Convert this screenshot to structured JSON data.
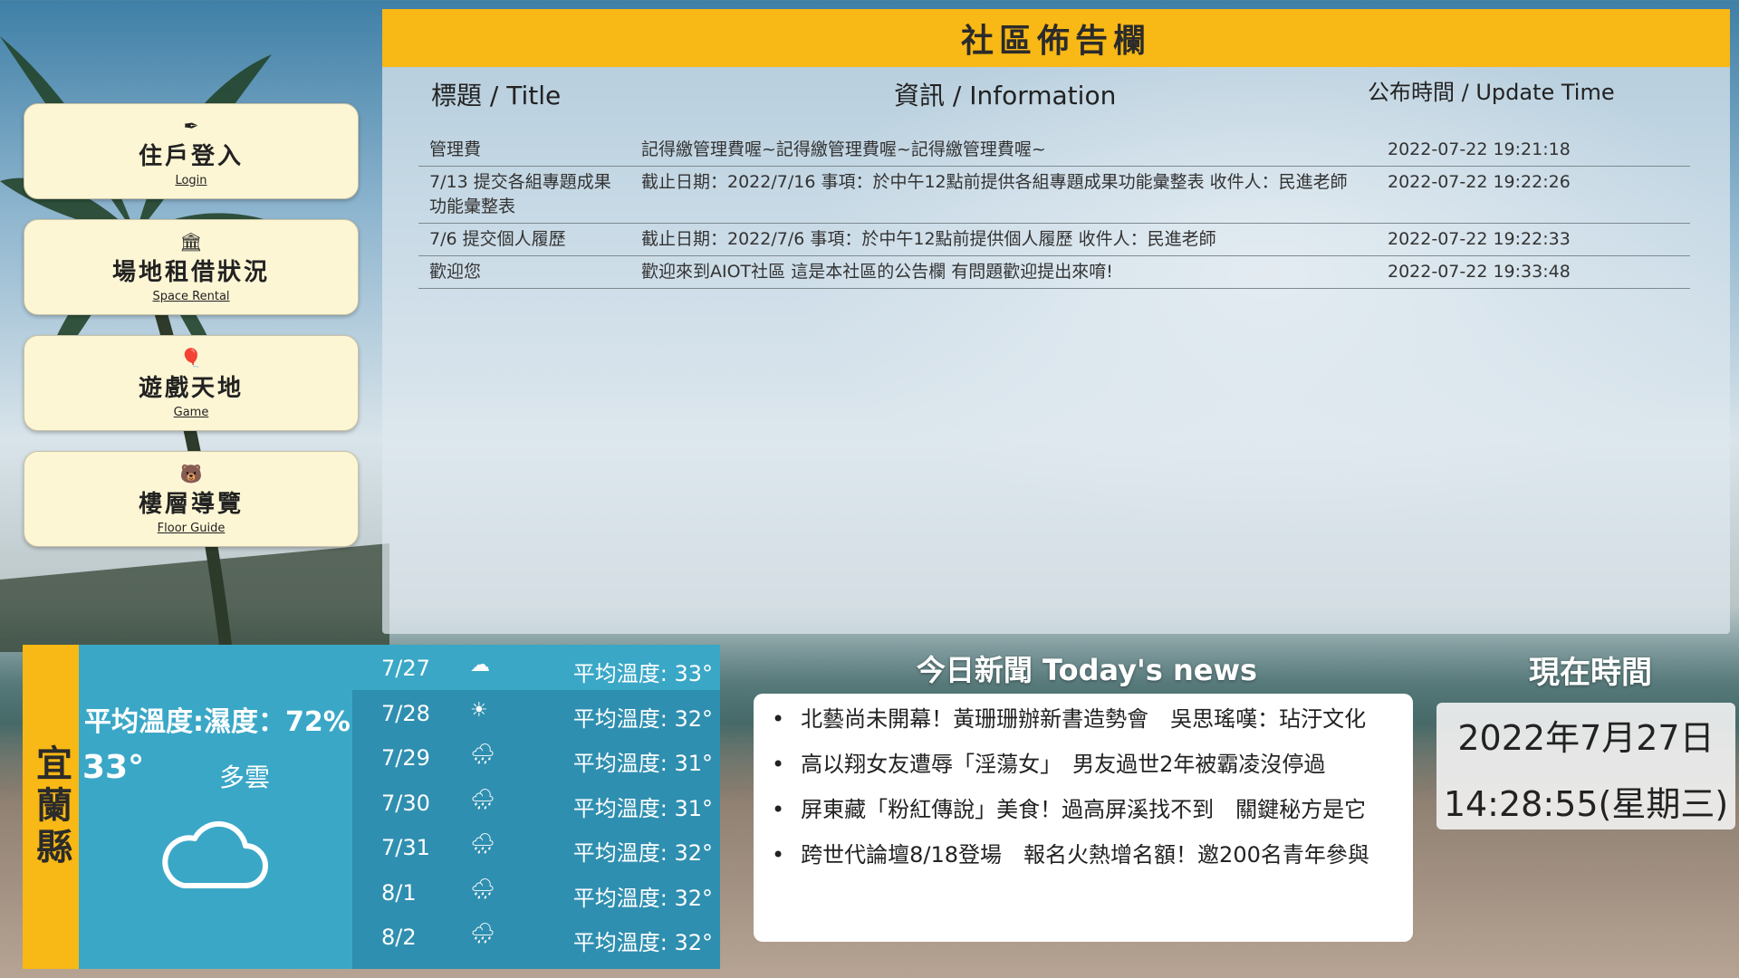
{
  "menu": [
    {
      "icon": "feather-icon",
      "glyph": "✒",
      "title": "住戶登入",
      "subtitle": "Login"
    },
    {
      "icon": "building-icon",
      "glyph": "🏛",
      "title": "場地租借狀況",
      "subtitle": "Space Rental"
    },
    {
      "icon": "balloon-icon",
      "glyph": "🎈",
      "title": "遊戲天地",
      "subtitle": "Game"
    },
    {
      "icon": "bear-icon",
      "glyph": "🐻",
      "title": "樓層導覽",
      "subtitle": "Floor Guide"
    }
  ],
  "bulletin": {
    "header": "社區佈告欄",
    "col_title": "標題 / Title",
    "col_info": "資訊 / Information",
    "col_time": "公布時間 / Update Time",
    "rows": [
      {
        "title": "管理費",
        "info": "記得繳管理費喔~記得繳管理費喔~記得繳管理費喔~",
        "time": "2022-07-22 19:21:18"
      },
      {
        "title": "7/13 提交各組專題成果功能彙整表",
        "info": "截止日期：2022/7/16 事項：於中午12點前提供各組專題成果功能彙整表 收件人：民進老師",
        "time": "2022-07-22 19:22:26"
      },
      {
        "title": "7/6 提交個人履歷",
        "info": "截止日期：2022/7/6 事項：於中午12點前提供個人履歷 收件人：民進老師",
        "time": "2022-07-22 19:22:33"
      },
      {
        "title": "歡迎您",
        "info": "歡迎來到AIOT社區 這是本社區的公告欄 有問題歡迎提出來唷!",
        "time": "2022-07-22 19:33:48"
      }
    ]
  },
  "weather": {
    "city": "宜蘭縣",
    "humidity_text": "平均溫度:濕度：72%",
    "temp": "33°",
    "condition": "多雲",
    "icon": "cloud-icon",
    "forecast": [
      {
        "date": "7/27",
        "icon": "cloud-icon",
        "glyph": "☁",
        "avg": "平均溫度: 33°"
      },
      {
        "date": "7/28",
        "icon": "sun-icon",
        "glyph": "☀",
        "avg": "平均溫度: 32°"
      },
      {
        "date": "7/29",
        "icon": "rain-icon",
        "glyph": "🌧",
        "avg": "平均溫度: 31°"
      },
      {
        "date": "7/30",
        "icon": "rain-icon",
        "glyph": "🌧",
        "avg": "平均溫度: 31°"
      },
      {
        "date": "7/31",
        "icon": "rain-icon",
        "glyph": "🌧",
        "avg": "平均溫度: 32°"
      },
      {
        "date": "8/1",
        "icon": "rain-icon",
        "glyph": "🌧",
        "avg": "平均溫度: 32°"
      },
      {
        "date": "8/2",
        "icon": "rain-icon",
        "glyph": "🌧",
        "avg": "平均溫度: 32°"
      }
    ]
  },
  "news": {
    "title": "今日新聞 Today's news",
    "items": [
      "北藝尚未開幕！黃珊珊辦新書造勢會　吳思瑤嘆：玷汙文化",
      "高以翔女友遭辱「淫蕩女」　男友過世2年被霸凌沒停過",
      "屏東藏「粉紅傳說」美食！過高屏溪找不到　關鍵秘方是它",
      "跨世代論壇8/18登場　報名火熱增名額！邀200名青年參與"
    ]
  },
  "clock": {
    "title": "現在時間",
    "date": "2022年7月27日",
    "time": "14:28:55(星期三)"
  }
}
